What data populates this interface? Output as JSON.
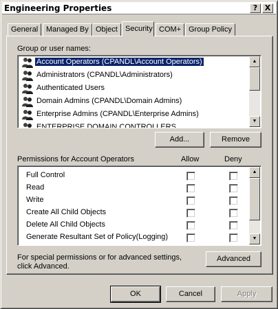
{
  "window": {
    "title": "Engineering Properties",
    "help_button": "?",
    "close_button": "X"
  },
  "tabs": [
    {
      "label": "General"
    },
    {
      "label": "Managed By"
    },
    {
      "label": "Object"
    },
    {
      "label": "Security",
      "active": true
    },
    {
      "label": "COM+"
    },
    {
      "label": "Group Policy"
    }
  ],
  "groups": {
    "label": "Group or user names:",
    "items": [
      {
        "name": "Account Operators (CPANDL\\Account Operators)",
        "selected": true
      },
      {
        "name": "Administrators (CPANDL\\Administrators)"
      },
      {
        "name": "Authenticated Users"
      },
      {
        "name": "Domain Admins (CPANDL\\Domain Admins)"
      },
      {
        "name": "Enterprise Admins (CPANDL\\Enterprise Admins)"
      },
      {
        "name": "ENTERPRISE DOMAIN CONTROLLERS"
      }
    ]
  },
  "buttons": {
    "add": "Add...",
    "remove": "Remove",
    "advanced": "Advanced",
    "ok": "OK",
    "cancel": "Cancel",
    "apply": "Apply"
  },
  "permissions": {
    "label": "Permissions for Account Operators",
    "allow_header": "Allow",
    "deny_header": "Deny",
    "items": [
      {
        "name": "Full Control",
        "allow": false,
        "deny": false
      },
      {
        "name": "Read",
        "allow": false,
        "deny": false
      },
      {
        "name": "Write",
        "allow": false,
        "deny": false
      },
      {
        "name": "Create All Child Objects",
        "allow": false,
        "deny": false
      },
      {
        "name": "Delete All Child Objects",
        "allow": false,
        "deny": false
      },
      {
        "name": "Generate Resultant Set of Policy(Logging)",
        "allow": false,
        "deny": false
      }
    ]
  },
  "advanced_note": {
    "line1": "For special permissions or for advanced settings,",
    "line2": "click Advanced."
  },
  "icons": {
    "user_group": "user-group-icon",
    "scroll_up": "scroll-up-arrow-icon",
    "scroll_down": "scroll-down-arrow-icon"
  },
  "colors": {
    "face": "#d4d0c8",
    "selection": "#0a246a",
    "window_bg": "#ffffff"
  }
}
